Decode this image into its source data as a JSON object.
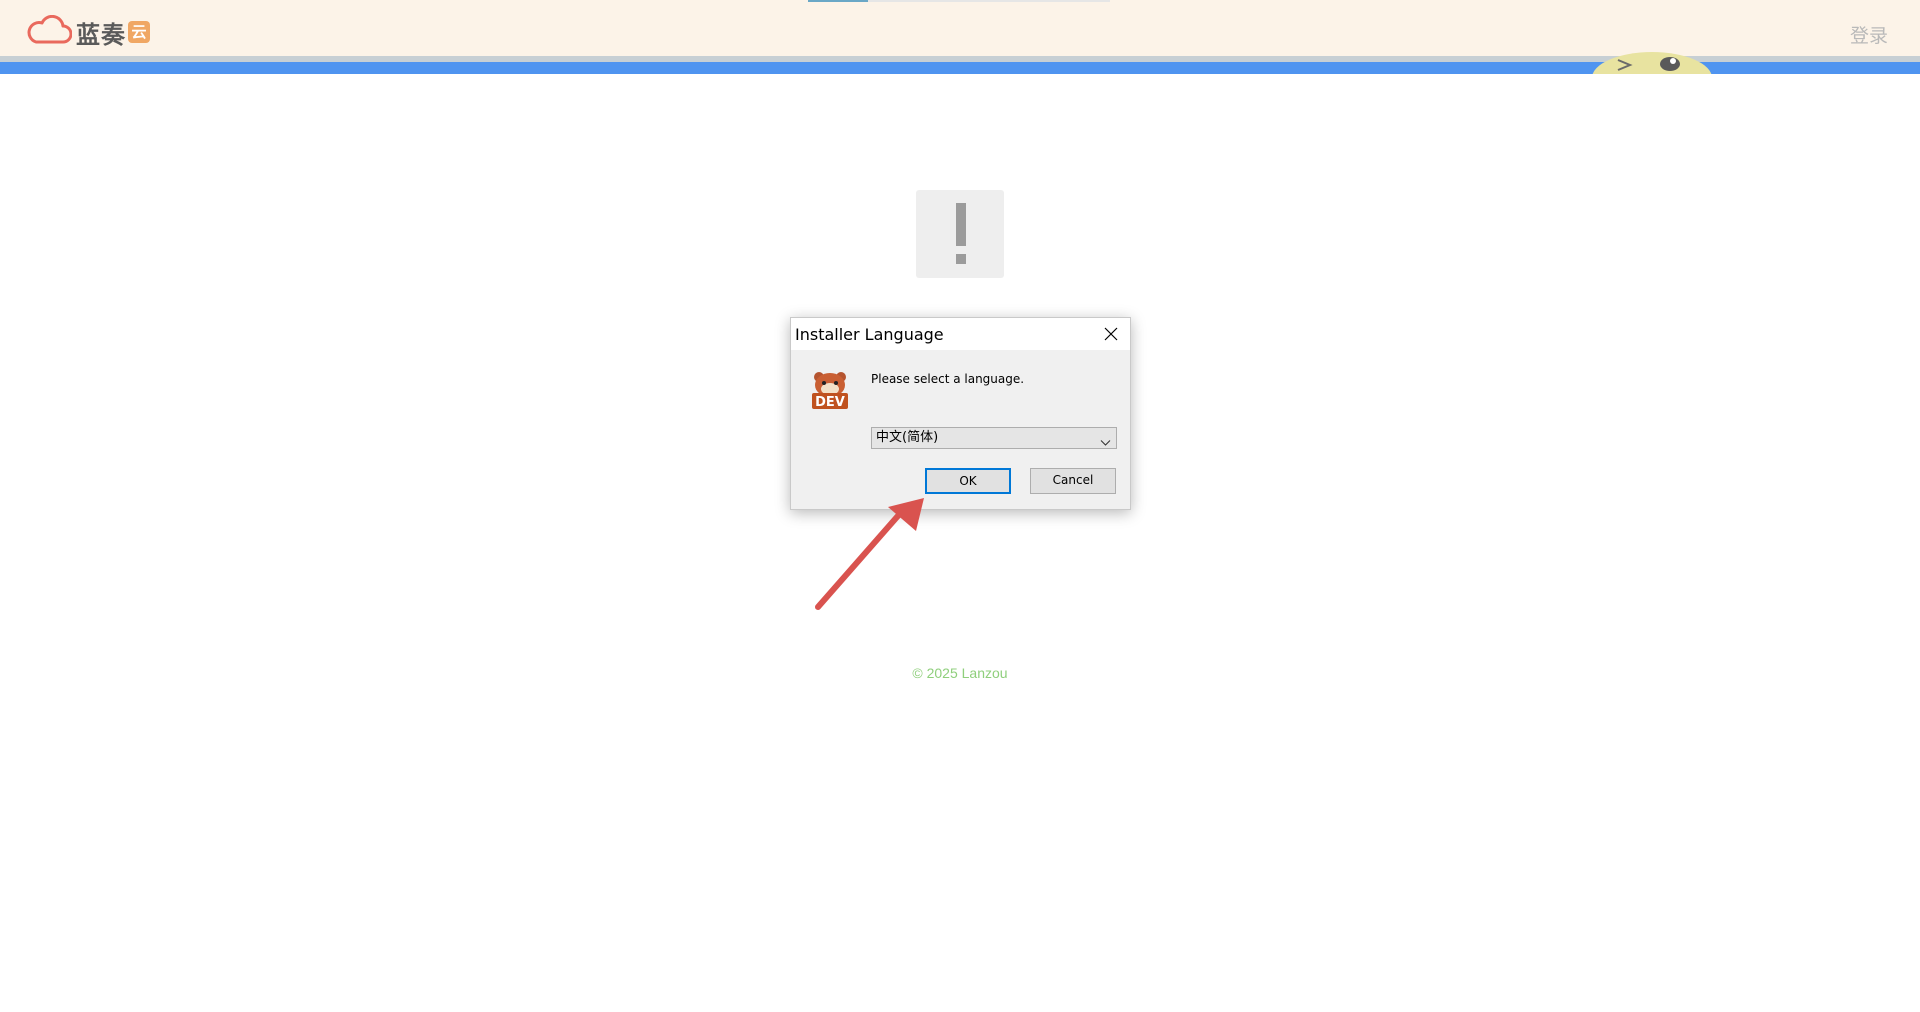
{
  "header": {
    "logo_text": "蓝奏",
    "logo_badge": "云",
    "login_label": "登录"
  },
  "dialog": {
    "title": "Installer Language",
    "message": "Please select a language.",
    "selected_language": "中文(简体)",
    "ok_label": "OK",
    "cancel_label": "Cancel",
    "icon_badge_text": "DEV"
  },
  "footer": {
    "copyright": "© 2025 Lanzou"
  },
  "colors": {
    "header_bg": "#fcf3e8",
    "blue_strip": "#4f94f0",
    "accent_red_arrow": "#d9534f",
    "copyright_green": "#8fcf7c",
    "ok_focus_border": "#0078d7"
  },
  "icons": {
    "logo": "cloud-icon",
    "alert": "exclamation-icon",
    "close": "close-icon",
    "dropdown": "chevron-down-icon",
    "installer": "dev-badge-icon",
    "annotation": "arrow-icon"
  }
}
